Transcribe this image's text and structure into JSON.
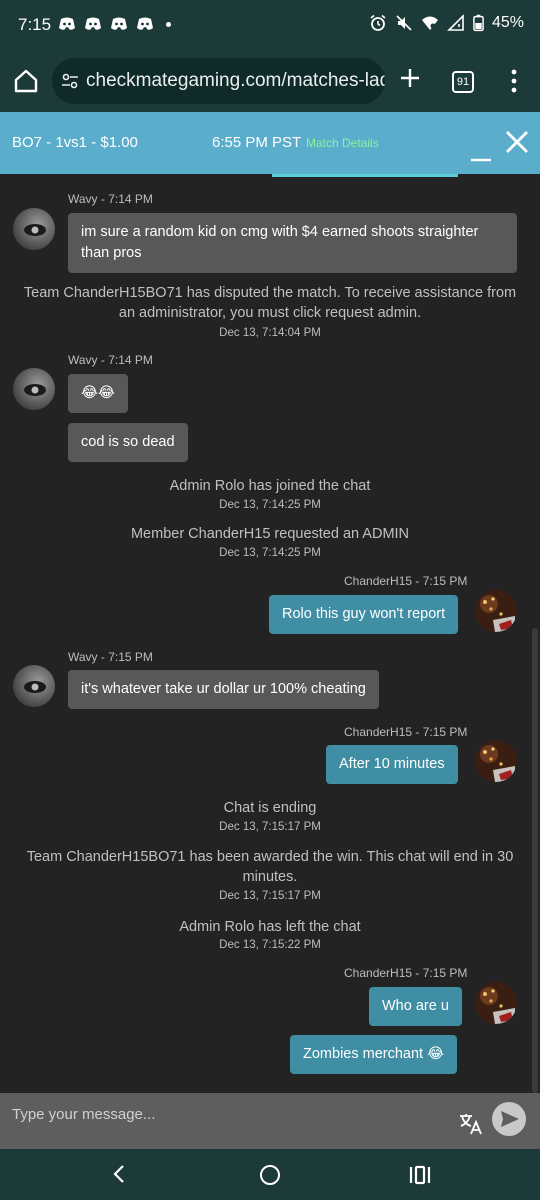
{
  "status_bar": {
    "time": "7:15",
    "battery": "45%",
    "icons": [
      "discord-icon",
      "discord-icon",
      "discord-icon",
      "discord-icon",
      "dot-icon",
      "alarm-icon",
      "mute-icon",
      "wifi-icon",
      "signal-icon",
      "battery-icon"
    ]
  },
  "browser": {
    "url": "checkmategaming.com/matches-ladd",
    "tab_count": "91"
  },
  "match_header": {
    "title": "BO7 - 1vs1 - $1.00",
    "time": "6:55 PM PST",
    "details_link": "Match Details"
  },
  "chat": {
    "messages": [
      {
        "type": "user",
        "side": "left",
        "name": "Wavy - 7:14 PM",
        "bubbles": [
          "im sure a random kid on cmg with $4 earned shoots straighter than pros"
        ]
      },
      {
        "type": "system",
        "text": "Team ChanderH15BO71 has disputed the match. To receive assistance from an administrator, you must click request admin.",
        "timestamp": "Dec 13, 7:14:04 PM"
      },
      {
        "type": "user",
        "side": "left",
        "name": "Wavy - 7:14 PM",
        "bubbles": [
          "😂😂",
          "cod is so dead"
        ]
      },
      {
        "type": "system",
        "text": "Admin Rolo has joined the chat",
        "timestamp": "Dec 13, 7:14:25 PM"
      },
      {
        "type": "system",
        "text": "Member ChanderH15 requested an ADMIN",
        "timestamp": "Dec 13, 7:14:25 PM"
      },
      {
        "type": "user",
        "side": "right",
        "name": "ChanderH15 - 7:15 PM",
        "bubbles": [
          "Rolo this guy won't report"
        ]
      },
      {
        "type": "user",
        "side": "left",
        "name": "Wavy - 7:15 PM",
        "bubbles": [
          "it's whatever take ur dollar ur 100% cheating"
        ]
      },
      {
        "type": "user",
        "side": "right",
        "name": "ChanderH15 - 7:15 PM",
        "bubbles": [
          "After 10 minutes"
        ]
      },
      {
        "type": "system",
        "text": "Chat is ending",
        "timestamp": "Dec 13, 7:15:17 PM"
      },
      {
        "type": "system",
        "text": "Team ChanderH15BO71 has been awarded the win. This chat will end in 30 minutes.",
        "timestamp": "Dec 13, 7:15:17 PM"
      },
      {
        "type": "system",
        "text": "Admin Rolo has left the chat",
        "timestamp": "Dec 13, 7:15:22 PM"
      },
      {
        "type": "user",
        "side": "right",
        "name": "ChanderH15 - 7:15 PM",
        "bubbles": [
          "Who are u",
          "Zombies merchant 😂"
        ]
      }
    ]
  },
  "input": {
    "placeholder": "Type your message..."
  },
  "colors": {
    "status_bg": "#1c3a38",
    "match_header_bg": "#5aaecb",
    "match_details": "#8cf29a",
    "left_bubble": "#585858",
    "right_bubble": "#3f8ea4",
    "chat_bg": "#232323",
    "input_bg": "#5e5e5e"
  }
}
